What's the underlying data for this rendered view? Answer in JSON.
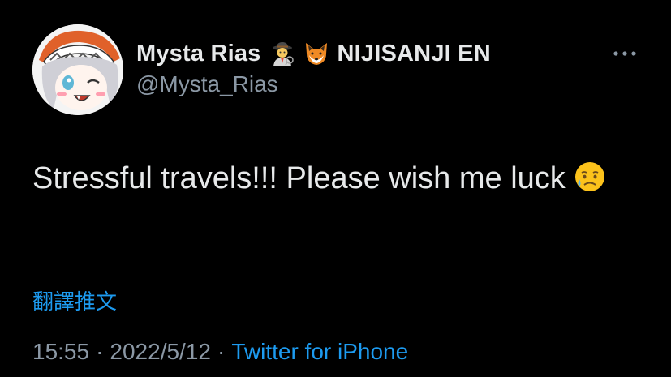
{
  "author": {
    "display_name": "Mysta Rias",
    "emoji_1": "detective-emoji",
    "emoji_2": "fox-emoji",
    "affiliation": "NIJISANJI EN",
    "handle": "@Mysta_Rias"
  },
  "tweet": {
    "text": "Stressful travels!!! Please wish me luck",
    "emoji": "sad-but-relieved-face-emoji",
    "translate_label": "翻譯推文"
  },
  "meta": {
    "time": "15:55",
    "separator": "·",
    "date": "2022/5/12",
    "source": "Twitter for iPhone"
  },
  "more_icon": "ellipsis-icon",
  "colors": {
    "background": "#000000",
    "primary_text": "#e7e9ea",
    "secondary_text": "#8b98a5",
    "link": "#1d9bf0"
  }
}
